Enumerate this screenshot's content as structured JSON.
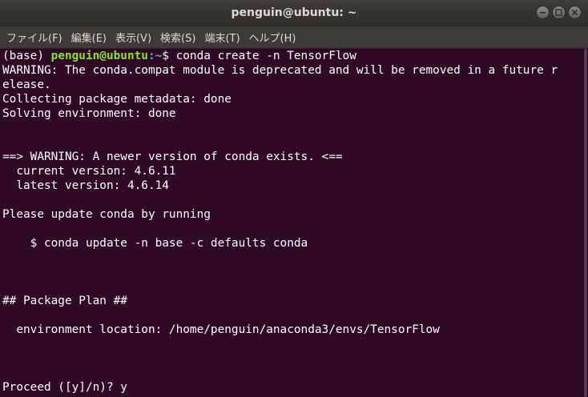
{
  "window": {
    "title": "penguin@ubuntu: ~"
  },
  "menubar": {
    "items": [
      "ファイル(F)",
      "編集(E)",
      "表示(V)",
      "検索(S)",
      "端末(T)",
      "ヘルプ(H)"
    ]
  },
  "prompt": {
    "env": "(base) ",
    "user_host": "penguin@ubuntu",
    "path": ":~",
    "symbol": "$ ",
    "command": "conda create -n TensorFlow"
  },
  "output": [
    "WARNING: The conda.compat module is deprecated and will be removed in a future r",
    "elease.",
    "Collecting package metadata: done",
    "Solving environment: done",
    "",
    "",
    "==> WARNING: A newer version of conda exists. <==",
    "  current version: 4.6.11",
    "  latest version: 4.6.14",
    "",
    "Please update conda by running",
    "",
    "    $ conda update -n base -c defaults conda",
    "",
    "",
    "",
    "## Package Plan ##",
    "",
    "  environment location: /home/penguin/anaconda3/envs/TensorFlow",
    "",
    "",
    "",
    "Proceed ([y]/n)? y"
  ],
  "icons": {
    "minimize": "minimize-icon",
    "maximize": "maximize-icon",
    "close": "close-icon"
  },
  "colors": {
    "terminal_bg": "#300a24",
    "prompt_user": "#8ae234",
    "prompt_path": "#729fcf",
    "text": "#ffffff"
  }
}
